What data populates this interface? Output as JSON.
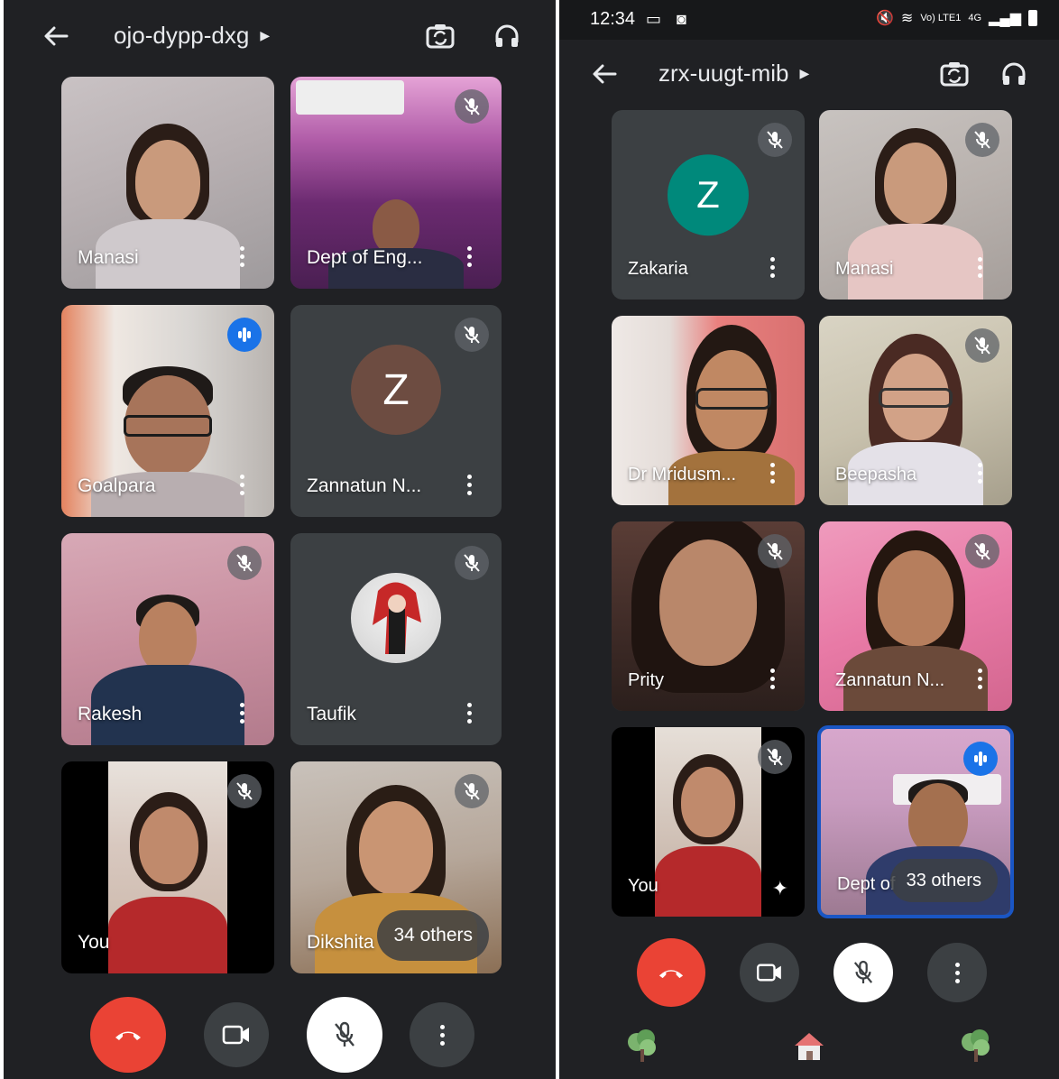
{
  "left": {
    "meeting_code": "ojo-dypp-dxg",
    "tiles": [
      {
        "name": "Manasi"
      },
      {
        "name": "Dept of Eng..."
      },
      {
        "name": "Goalpara"
      },
      {
        "name": "Zannatun N...",
        "initial": "Z"
      },
      {
        "name": "Rakesh"
      },
      {
        "name": "Taufik"
      },
      {
        "name": "You"
      },
      {
        "name": "Dikshita",
        "others": "34 others"
      }
    ]
  },
  "right": {
    "status": {
      "time": "12:34",
      "network": "Vo) LTE1",
      "signal": "4G"
    },
    "meeting_code": "zrx-uugt-mib",
    "tiles": [
      {
        "name": "Zakaria",
        "initial": "Z"
      },
      {
        "name": "Manasi"
      },
      {
        "name": "Dr Mridusm..."
      },
      {
        "name": "Beepasha"
      },
      {
        "name": "Prity"
      },
      {
        "name": "Zannatun N..."
      },
      {
        "name": "You"
      },
      {
        "name": "Dept of",
        "others": "33 others"
      }
    ]
  },
  "colors": {
    "background": "#202124",
    "tile": "#3c4043",
    "end_call": "#ea4335",
    "speaking": "#1a73e8",
    "avatar_zannatun": "#6d4c41",
    "avatar_zakaria": "#00897b"
  },
  "icons": [
    "back-arrow-icon",
    "caret-right-icon",
    "switch-camera-icon",
    "headphones-icon",
    "mic-off-icon",
    "speaking-indicator-icon",
    "more-vert-icon",
    "end-call-icon",
    "camera-icon",
    "sparkle-effects-icon",
    "tree-icon",
    "home-icon"
  ]
}
